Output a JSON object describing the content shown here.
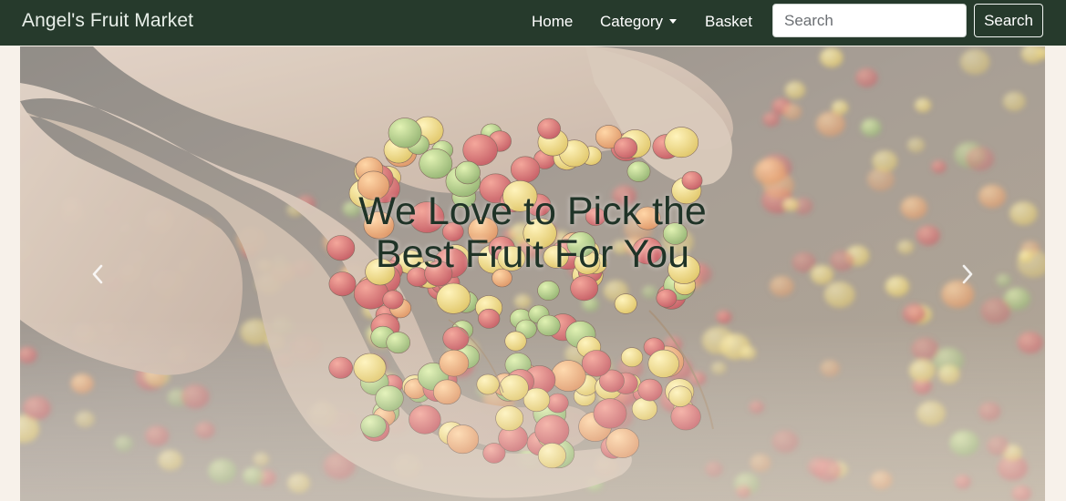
{
  "navbar": {
    "brand": "Angel's Fruit Market",
    "links": {
      "home": "Home",
      "category": "Category",
      "basket": "Basket"
    },
    "search": {
      "placeholder": "Search",
      "button_label": "Search"
    }
  },
  "hero": {
    "caption_line1": "We Love to Pick the",
    "caption_line2": "Best Fruit For You",
    "image_description": "hands holding coffee cherries",
    "prev_icon": "chevron-left-icon",
    "next_icon": "chevron-right-icon"
  },
  "colors": {
    "navbar_bg": "#263a2c",
    "page_bg": "#f7f1ea",
    "caption_text": "#1f3327"
  }
}
